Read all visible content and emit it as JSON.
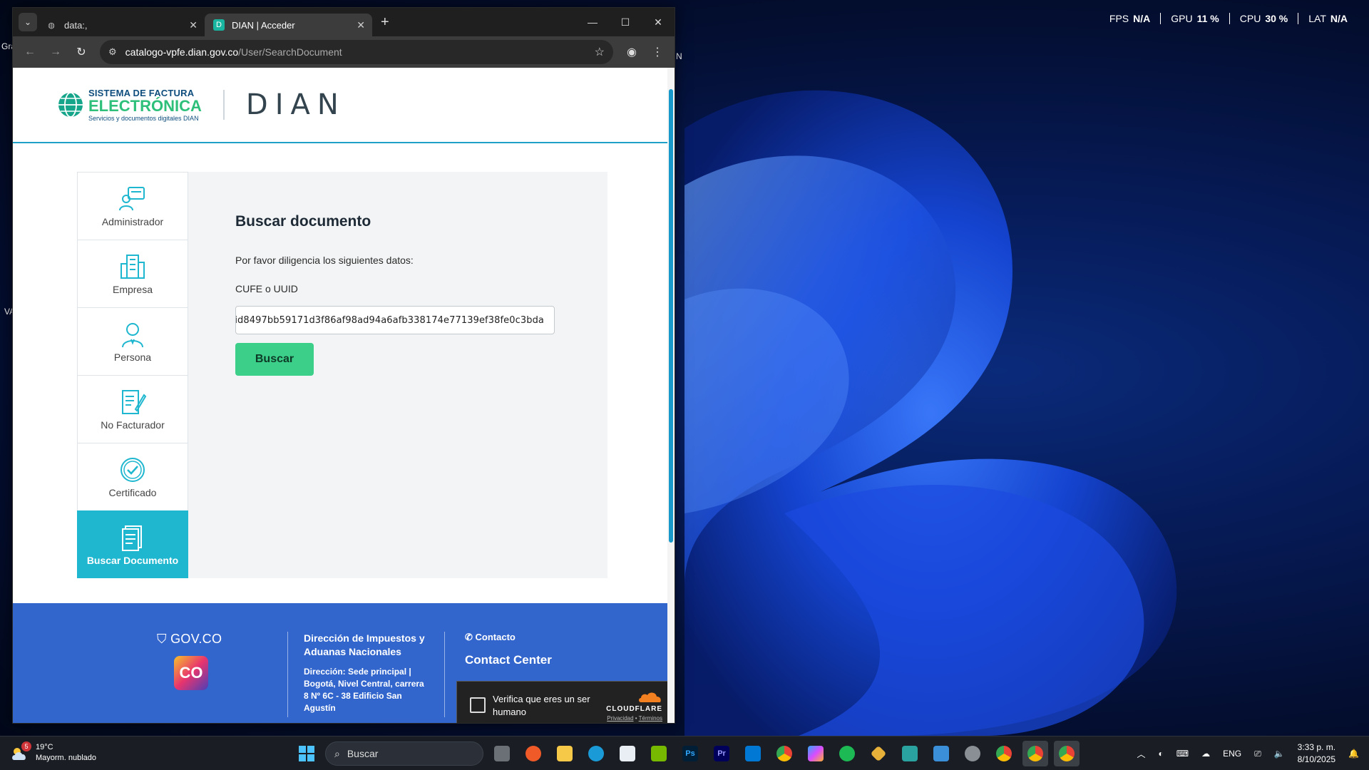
{
  "perf": {
    "fps_label": "FPS",
    "fps_value": "N/A",
    "gpu_label": "GPU",
    "gpu_value": "11 %",
    "cpu_label": "CPU",
    "cpu_value": "30 %",
    "lat_label": "LAT",
    "lat_value": "N/A"
  },
  "desktop": {
    "stray1": "Gra",
    "stray2": "VA",
    "stray3": "N"
  },
  "browser": {
    "tabs": [
      {
        "title": "data:,",
        "active": false
      },
      {
        "title": "DIAN | Acceder",
        "active": true
      }
    ],
    "url_host": "catalogo-vpfe.dian.gov.co",
    "url_path": "/User/SearchDocument"
  },
  "header": {
    "sfe_line1a": "SISTEMA DE ",
    "sfe_line1b": "FACTURA",
    "sfe_line2": "ELECTRÓNICA",
    "sfe_line3": "Servicios y documentos digitales DIAN",
    "dian_logo": "DIAN"
  },
  "sidebar": {
    "items": [
      {
        "label": "Administrador",
        "icon": "admin-icon"
      },
      {
        "label": "Empresa",
        "icon": "building-icon"
      },
      {
        "label": "Persona",
        "icon": "person-icon"
      },
      {
        "label": "No Facturador",
        "icon": "document-edit-icon"
      },
      {
        "label": "Certificado",
        "icon": "certificate-check-icon"
      },
      {
        "label": "Buscar Documento",
        "icon": "search-document-icon",
        "active": true
      }
    ]
  },
  "main": {
    "title": "Buscar documento",
    "intro": "Por favor diligencia los siguientes datos:",
    "field_label": "CUFE o UUID",
    "field_value": "id8497bb59171d3f86af98ad94a6afb338174e77139ef38fe0c3bda",
    "button_label": "Buscar"
  },
  "footer": {
    "govco": "GOV.CO",
    "colombia_logo": "CO",
    "org_name": "Dirección de Impuestos y Aduanas Nacionales",
    "address": "Dirección: Sede principal | Bogotá, Nivel Central, carrera 8 Nº 6C - 38 Edificio San Agustín",
    "contact_label": "Contacto",
    "contact_center": "Contact Center"
  },
  "turnstile": {
    "text": "Verifica que eres un ser humano",
    "brand": "CLOUDFLARE",
    "privacy": "Privacidad",
    "sep": " • ",
    "terms": "Términos"
  },
  "taskbar": {
    "weather_badge": "5",
    "weather_temp": "19°C",
    "weather_desc": "Mayorm. nublado",
    "search_placeholder": "Buscar",
    "lang": "ENG",
    "time": "3:33 p. m.",
    "date": "8/10/2025"
  },
  "colors": {
    "accent_teal": "#1fb7cf",
    "button_green": "#3ccf8a",
    "footer_blue": "#3366cc"
  }
}
